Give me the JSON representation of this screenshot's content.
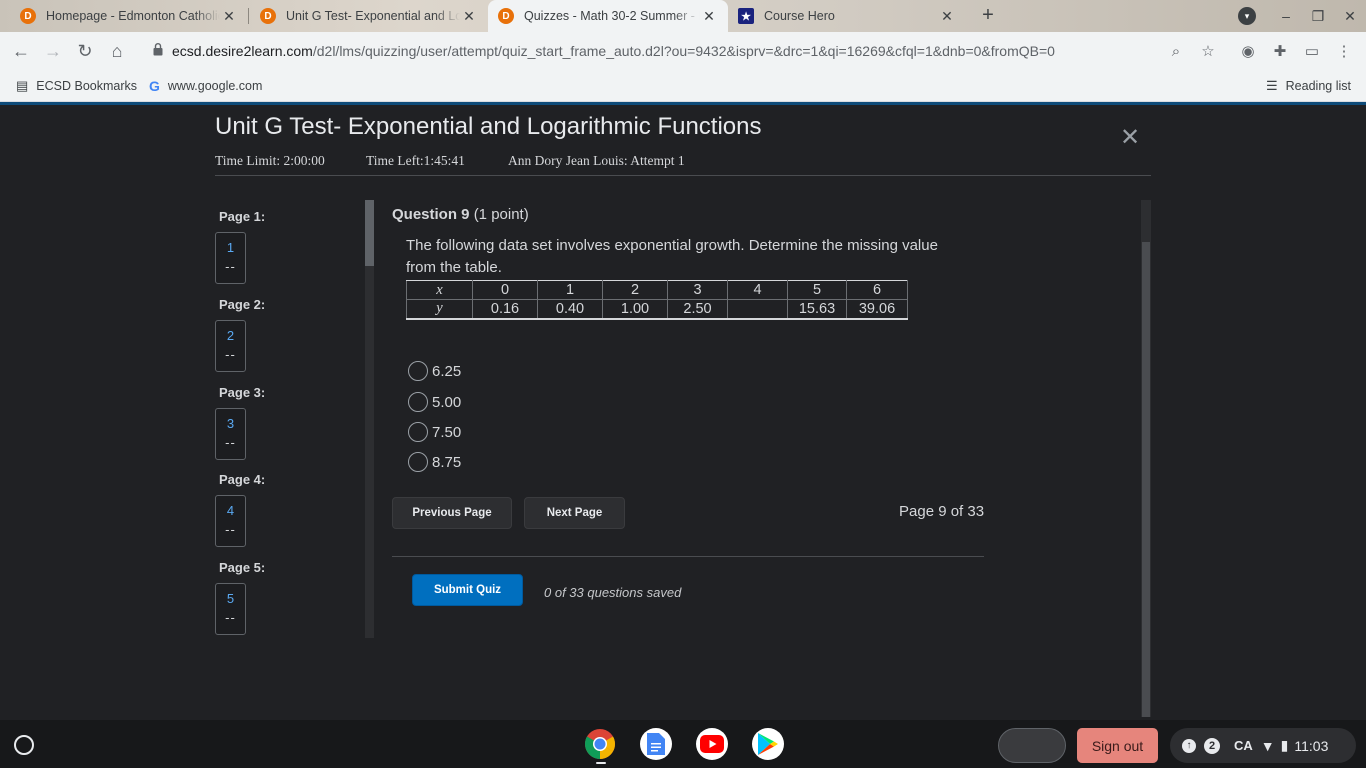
{
  "browser": {
    "tabs": [
      {
        "title": "Homepage - Edmonton Catholic",
        "favicon": "d2l-icon"
      },
      {
        "title": "Unit G Test- Exponential and Logarithmic",
        "favicon": "d2l-icon"
      },
      {
        "title": "Quizzes - Math 30-2 Summer - Ed",
        "favicon": "d2l-icon",
        "active": true
      },
      {
        "title": "Course Hero",
        "favicon": "coursehero-icon"
      }
    ],
    "url_host": "ecsd.desire2learn.com",
    "url_path": "/d2l/lms/quizzing/user/attempt/quiz_start_frame_auto.d2l?ou=9432&isprv=&drc=1&qi=16269&cfql=1&dnb=0&fromQB=0",
    "bookmarks": [
      "ECSD Bookmarks",
      "www.google.com"
    ],
    "reading_list": "Reading list"
  },
  "quiz": {
    "title": "Unit G Test- Exponential and Logarithmic Functions",
    "time_limit": "Time Limit: 2:00:00",
    "time_left": "Time Left:1:45:41",
    "attempt": "Ann Dory Jean Louis: Attempt 1",
    "pages": [
      {
        "label": "Page 1:",
        "number": "1",
        "status": "--"
      },
      {
        "label": "Page 2:",
        "number": "2",
        "status": "--"
      },
      {
        "label": "Page 3:",
        "number": "3",
        "status": "--"
      },
      {
        "label": "Page 4:",
        "number": "4",
        "status": "--"
      },
      {
        "label": "Page 5:",
        "number": "5",
        "status": "--"
      }
    ],
    "question": {
      "number": "Question 9",
      "points": "(1 point)",
      "text": "The following data set involves exponential growth. Determine the missing value from the table.",
      "table": {
        "x_label": "x",
        "y_label": "y",
        "x": [
          "0",
          "1",
          "2",
          "3",
          "4",
          "5",
          "6"
        ],
        "y": [
          "0.16",
          "0.40",
          "1.00",
          "2.50",
          "",
          "15.63",
          "39.06"
        ]
      },
      "options": [
        "6.25",
        "5.00",
        "7.50",
        "8.75"
      ]
    },
    "prev_label": "Previous Page",
    "next_label": "Next Page",
    "page_indicator": "Page 9 of 33",
    "submit_label": "Submit Quiz",
    "saved_status": "0 of 33 questions saved"
  },
  "shelf": {
    "signout_label": "Sign out",
    "notification_count": "2",
    "keyboard_layout": "CA",
    "clock": "11:03"
  },
  "colors": {
    "accent": "#006fbf",
    "signout": "#f28b82",
    "link": "#5aa9f2"
  }
}
